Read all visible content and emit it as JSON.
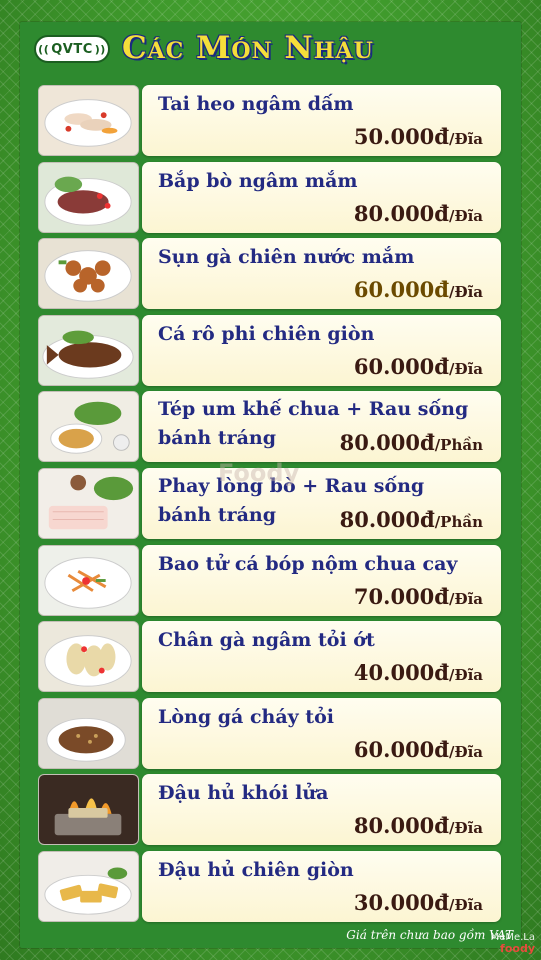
{
  "header": {
    "logo_text": "QVTC",
    "title": "Các Món Nhậu"
  },
  "items": [
    {
      "name_lines": [
        "Tai heo ngâm dấm"
      ],
      "price": "50.000đ",
      "unit": "/Đĩa",
      "image": "pickled-pig-ear"
    },
    {
      "name_lines": [
        "Bắp bò ngâm mắm"
      ],
      "price": "80.000đ",
      "unit": "/Đĩa",
      "image": "pickled-beef-shank"
    },
    {
      "name_lines": [
        "Sụn gà chiên nước mắm"
      ],
      "price": "60.000đ",
      "unit": "/Đĩa",
      "image": "fried-chicken-cartilage"
    },
    {
      "name_lines": [
        "Cá rô phi chiên giòn"
      ],
      "price": "60.000đ",
      "unit": "/Đĩa",
      "image": "crispy-fried-tilapia"
    },
    {
      "name_lines": [
        "Tép um khế chua + Rau sống",
        "bánh tráng"
      ],
      "price": "80.000đ",
      "unit": "/Phần",
      "image": "shrimp-starfruit"
    },
    {
      "name_lines": [
        "Phay lòng bò + Rau sống",
        "bánh tráng"
      ],
      "price": "80.000đ",
      "unit": "/Phần",
      "image": "beef-tripe-rolls"
    },
    {
      "name_lines": [
        "Bao tử cá bóp nộm chua cay"
      ],
      "price": "70.000đ",
      "unit": "/Đĩa",
      "image": "fish-maw-salad"
    },
    {
      "name_lines": [
        "Chân gà ngâm tỏi ớt"
      ],
      "price": "40.000đ",
      "unit": "/Đĩa",
      "image": "chicken-feet-garlic-chili"
    },
    {
      "name_lines": [
        "Lòng gá cháy tỏi"
      ],
      "price": "60.000đ",
      "unit": "/Đĩa",
      "image": "garlic-fried-offal"
    },
    {
      "name_lines": [
        "Đậu hủ khói lửa"
      ],
      "price": "80.000đ",
      "unit": "/Đĩa",
      "image": "flaming-tofu"
    },
    {
      "name_lines": [
        "Đậu hủ chiên giòn"
      ],
      "price": "30.000đ",
      "unit": "/Đĩa",
      "image": "crispy-fried-tofu"
    }
  ],
  "footnote": "Giá trên chưa bao gồm VAT",
  "watermarks": {
    "center": "Foody",
    "corner_line1": "MeMe.La",
    "corner_line2": "foody"
  },
  "colors": {
    "background": "#3d8a2a",
    "title": "#f5de3a",
    "item_name": "#232a82",
    "price": "#3a1a12"
  }
}
